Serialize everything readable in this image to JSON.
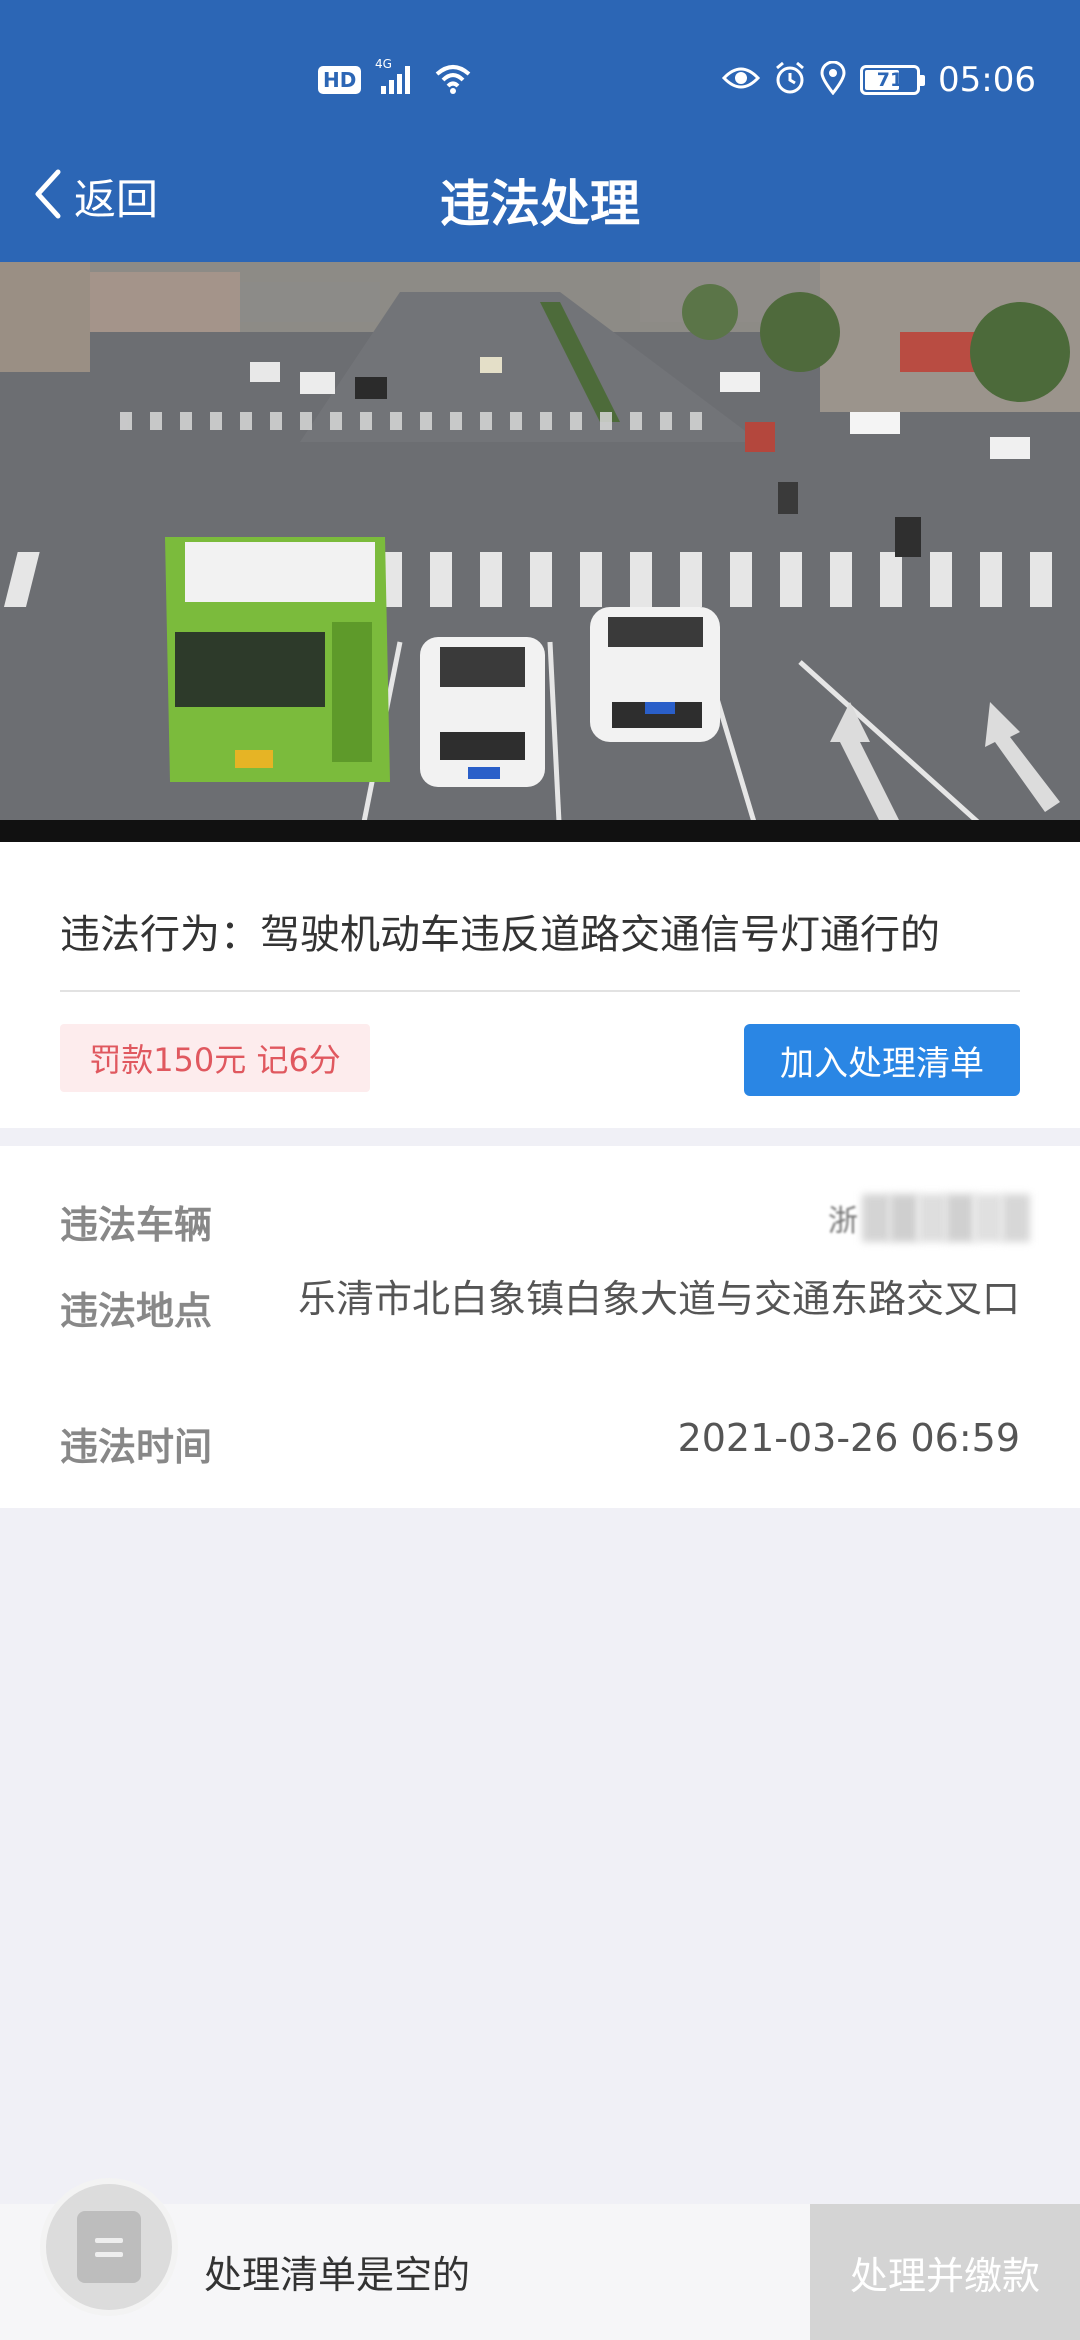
{
  "status_bar": {
    "hd": "HD",
    "network": "4G",
    "battery": "71",
    "battery_level": 0.71,
    "time": "05:06"
  },
  "nav": {
    "back_label": "返回",
    "title": "违法处理"
  },
  "violation": {
    "behavior": "违法行为：驾驶机动车违反道路交通信号灯通行的",
    "penalty": "罚款150元 记6分",
    "add_button": "加入处理清单"
  },
  "details": {
    "vehicle_label": "违法车辆",
    "vehicle_value_partial": "浙",
    "location_label": "违法地点",
    "location_value": "乐清市北白象镇白象大道与交通东路交叉口",
    "time_label": "违法时间",
    "time_value": "2021-03-26 06:59"
  },
  "bottom": {
    "empty_text": "处理清单是空的",
    "pay_button": "处理并缴款"
  },
  "colors": {
    "header": "#2c66b5",
    "primary_button": "#2a86e4",
    "penalty_bg": "#fdeced",
    "penalty_text": "#e0585f"
  }
}
